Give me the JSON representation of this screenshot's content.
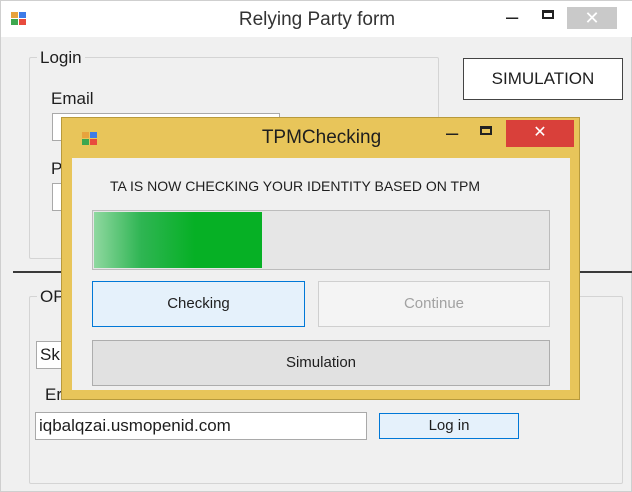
{
  "main_window": {
    "title": "Relying Party form",
    "caption_buttons": {
      "minimize": "–",
      "maximize": "☐",
      "close": "✕"
    },
    "icon": "app-icon",
    "login_group": {
      "title": "Login",
      "email_label": "Email",
      "email_value": "",
      "password_label_partial": "P",
      "password_value": ""
    },
    "simulation_button": "SIMULATION",
    "openid_group": {
      "title_partial": "OP",
      "provider_value_partial": "Sk",
      "email_label_partial": "Er",
      "email_value": "iqbalqzai.usmopenid.com",
      "login_button": "Log in"
    }
  },
  "dialog": {
    "title": "TPMChecking",
    "caption_buttons": {
      "minimize": "–",
      "maximize": "☐",
      "close": "✕"
    },
    "icon": "app-icon",
    "message": "TA IS NOW CHECKING YOUR IDENTITY BASED ON TPM",
    "progress": 0.37,
    "checking_button": "Checking",
    "continue_button": "Continue",
    "continue_enabled": false,
    "simulation_button": "Simulation"
  },
  "colors": {
    "dialog_frame": "#e8c55a",
    "close_button": "#d9403a",
    "progress_fill": "#06b025",
    "focus_border": "#0078d7"
  }
}
